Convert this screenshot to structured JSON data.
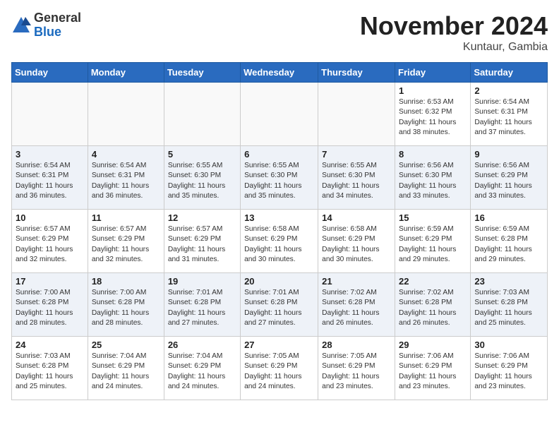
{
  "header": {
    "logo_general": "General",
    "logo_blue": "Blue",
    "month_title": "November 2024",
    "location": "Kuntaur, Gambia"
  },
  "weekdays": [
    "Sunday",
    "Monday",
    "Tuesday",
    "Wednesday",
    "Thursday",
    "Friday",
    "Saturday"
  ],
  "weeks": [
    [
      {
        "day": "",
        "info": ""
      },
      {
        "day": "",
        "info": ""
      },
      {
        "day": "",
        "info": ""
      },
      {
        "day": "",
        "info": ""
      },
      {
        "day": "",
        "info": ""
      },
      {
        "day": "1",
        "info": "Sunrise: 6:53 AM\nSunset: 6:32 PM\nDaylight: 11 hours and 38 minutes."
      },
      {
        "day": "2",
        "info": "Sunrise: 6:54 AM\nSunset: 6:31 PM\nDaylight: 11 hours and 37 minutes."
      }
    ],
    [
      {
        "day": "3",
        "info": "Sunrise: 6:54 AM\nSunset: 6:31 PM\nDaylight: 11 hours and 36 minutes."
      },
      {
        "day": "4",
        "info": "Sunrise: 6:54 AM\nSunset: 6:31 PM\nDaylight: 11 hours and 36 minutes."
      },
      {
        "day": "5",
        "info": "Sunrise: 6:55 AM\nSunset: 6:30 PM\nDaylight: 11 hours and 35 minutes."
      },
      {
        "day": "6",
        "info": "Sunrise: 6:55 AM\nSunset: 6:30 PM\nDaylight: 11 hours and 35 minutes."
      },
      {
        "day": "7",
        "info": "Sunrise: 6:55 AM\nSunset: 6:30 PM\nDaylight: 11 hours and 34 minutes."
      },
      {
        "day": "8",
        "info": "Sunrise: 6:56 AM\nSunset: 6:30 PM\nDaylight: 11 hours and 33 minutes."
      },
      {
        "day": "9",
        "info": "Sunrise: 6:56 AM\nSunset: 6:29 PM\nDaylight: 11 hours and 33 minutes."
      }
    ],
    [
      {
        "day": "10",
        "info": "Sunrise: 6:57 AM\nSunset: 6:29 PM\nDaylight: 11 hours and 32 minutes."
      },
      {
        "day": "11",
        "info": "Sunrise: 6:57 AM\nSunset: 6:29 PM\nDaylight: 11 hours and 32 minutes."
      },
      {
        "day": "12",
        "info": "Sunrise: 6:57 AM\nSunset: 6:29 PM\nDaylight: 11 hours and 31 minutes."
      },
      {
        "day": "13",
        "info": "Sunrise: 6:58 AM\nSunset: 6:29 PM\nDaylight: 11 hours and 30 minutes."
      },
      {
        "day": "14",
        "info": "Sunrise: 6:58 AM\nSunset: 6:29 PM\nDaylight: 11 hours and 30 minutes."
      },
      {
        "day": "15",
        "info": "Sunrise: 6:59 AM\nSunset: 6:29 PM\nDaylight: 11 hours and 29 minutes."
      },
      {
        "day": "16",
        "info": "Sunrise: 6:59 AM\nSunset: 6:28 PM\nDaylight: 11 hours and 29 minutes."
      }
    ],
    [
      {
        "day": "17",
        "info": "Sunrise: 7:00 AM\nSunset: 6:28 PM\nDaylight: 11 hours and 28 minutes."
      },
      {
        "day": "18",
        "info": "Sunrise: 7:00 AM\nSunset: 6:28 PM\nDaylight: 11 hours and 28 minutes."
      },
      {
        "day": "19",
        "info": "Sunrise: 7:01 AM\nSunset: 6:28 PM\nDaylight: 11 hours and 27 minutes."
      },
      {
        "day": "20",
        "info": "Sunrise: 7:01 AM\nSunset: 6:28 PM\nDaylight: 11 hours and 27 minutes."
      },
      {
        "day": "21",
        "info": "Sunrise: 7:02 AM\nSunset: 6:28 PM\nDaylight: 11 hours and 26 minutes."
      },
      {
        "day": "22",
        "info": "Sunrise: 7:02 AM\nSunset: 6:28 PM\nDaylight: 11 hours and 26 minutes."
      },
      {
        "day": "23",
        "info": "Sunrise: 7:03 AM\nSunset: 6:28 PM\nDaylight: 11 hours and 25 minutes."
      }
    ],
    [
      {
        "day": "24",
        "info": "Sunrise: 7:03 AM\nSunset: 6:28 PM\nDaylight: 11 hours and 25 minutes."
      },
      {
        "day": "25",
        "info": "Sunrise: 7:04 AM\nSunset: 6:29 PM\nDaylight: 11 hours and 24 minutes."
      },
      {
        "day": "26",
        "info": "Sunrise: 7:04 AM\nSunset: 6:29 PM\nDaylight: 11 hours and 24 minutes."
      },
      {
        "day": "27",
        "info": "Sunrise: 7:05 AM\nSunset: 6:29 PM\nDaylight: 11 hours and 24 minutes."
      },
      {
        "day": "28",
        "info": "Sunrise: 7:05 AM\nSunset: 6:29 PM\nDaylight: 11 hours and 23 minutes."
      },
      {
        "day": "29",
        "info": "Sunrise: 7:06 AM\nSunset: 6:29 PM\nDaylight: 11 hours and 23 minutes."
      },
      {
        "day": "30",
        "info": "Sunrise: 7:06 AM\nSunset: 6:29 PM\nDaylight: 11 hours and 23 minutes."
      }
    ]
  ]
}
